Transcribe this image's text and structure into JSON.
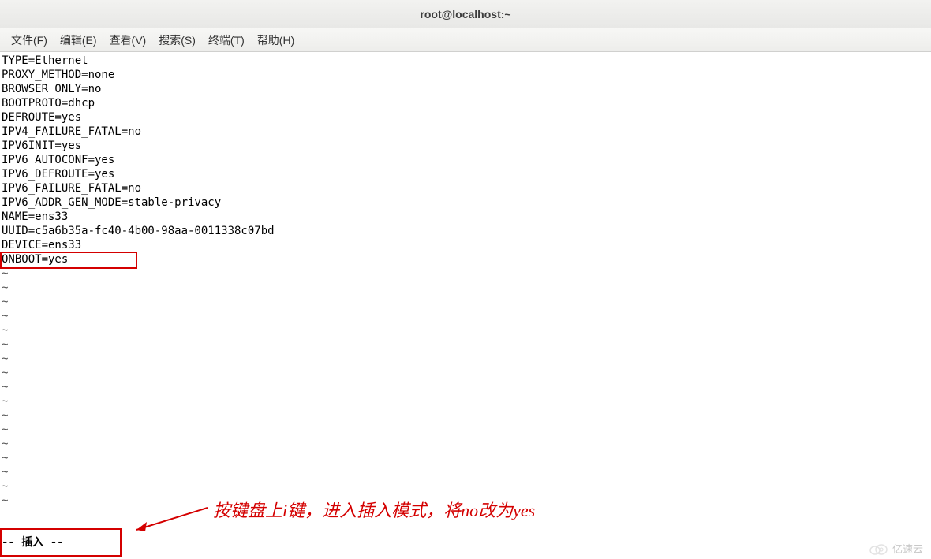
{
  "window": {
    "title": "root@localhost:~"
  },
  "menu": {
    "items": [
      "文件(F)",
      "编辑(E)",
      "查看(V)",
      "搜索(S)",
      "终端(T)",
      "帮助(H)"
    ]
  },
  "file_lines": [
    "TYPE=Ethernet",
    "PROXY_METHOD=none",
    "BROWSER_ONLY=no",
    "BOOTPROTO=dhcp",
    "DEFROUTE=yes",
    "IPV4_FAILURE_FATAL=no",
    "IPV6INIT=yes",
    "IPV6_AUTOCONF=yes",
    "IPV6_DEFROUTE=yes",
    "IPV6_FAILURE_FATAL=no",
    "IPV6_ADDR_GEN_MODE=stable-privacy",
    "NAME=ens33",
    "UUID=c5a6b35a-fc40-4b00-98aa-0011338c07bd",
    "DEVICE=ens33",
    "ONBOOT=yes"
  ],
  "tilde_count": 17,
  "status": "-- 插入 --",
  "annotation": "按键盘上i键，进入插入模式，将no改为yes",
  "watermark": "亿速云"
}
